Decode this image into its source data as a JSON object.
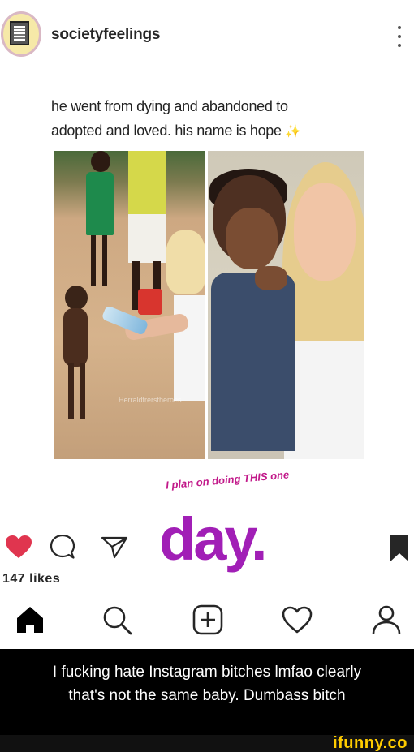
{
  "post": {
    "username": "societyfeelings",
    "caption_line1": "he went from dying and abandoned to",
    "caption_line2": "adopted and loved. his name is hope",
    "caption_emoji": "✨",
    "photo_watermark": "Herraldfrerstheroes",
    "overlay_note": "I plan on doing THIS one",
    "overlay_day": "day.",
    "likes_text": "147 likes"
  },
  "icons": {
    "more": "more-vertical-icon",
    "like": "heart-icon",
    "comment": "comment-icon",
    "share": "share-icon",
    "save": "bookmark-icon",
    "home": "home-icon",
    "search": "search-icon",
    "new_post": "add-post-icon",
    "activity": "activity-heart-icon",
    "profile": "profile-icon"
  },
  "colors": {
    "like_red": "#e0354f",
    "overlay_purple": "#a11fb6",
    "ifunny_yellow": "#ffcc00"
  },
  "meme_caption": {
    "line1": "I fucking hate Instagram bitches lmfao clearly",
    "line2": "that's not the same baby. Dumbass bitch"
  },
  "brand": {
    "logo": "ifunny.co"
  }
}
